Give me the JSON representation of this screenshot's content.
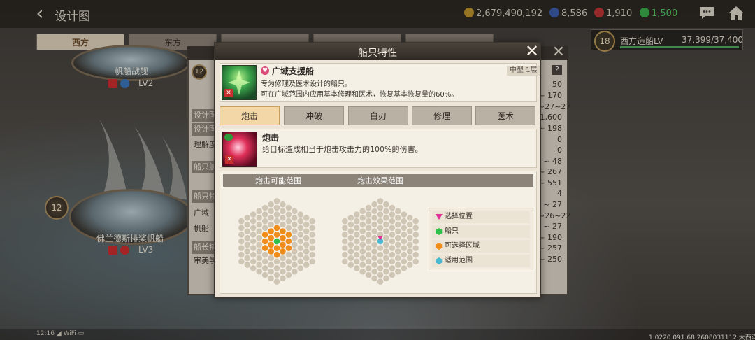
{
  "header": {
    "back_glyph": "‹",
    "title": "设计图"
  },
  "resources": [
    {
      "name": "gold",
      "value": "2,679,490,192",
      "color": "#b8912e"
    },
    {
      "name": "blue-gem",
      "value": "8,586",
      "color": "#3a5aa8"
    },
    {
      "name": "red-gem",
      "value": "1,910",
      "color": "#b83232"
    },
    {
      "name": "green-token",
      "value": "1,500",
      "color": "#3aa84a"
    }
  ],
  "top_icons": {
    "chat": "…",
    "home": "⌂"
  },
  "region_tabs": [
    "西方",
    "东方"
  ],
  "shipyard": {
    "level": "18",
    "label": "西方造船LV",
    "value": "37,399/37,400"
  },
  "ships": [
    {
      "name": "帆船战舰",
      "lv": "LV2"
    },
    {
      "name": "佛兰德斯排桨帆船",
      "lv": "LV3",
      "medal": "12"
    }
  ],
  "back_panel": {
    "medal": "12",
    "rows": [
      "设计图",
      "设计图",
      "理解度",
      "船只航",
      "船只特",
      "广域",
      "帆船",
      "船长搭",
      "审美学"
    ],
    "numbers": [
      "50",
      "~ 170",
      "~27~27",
      "1,600",
      "~ 198",
      "0",
      "0",
      "~ 48",
      "~ 267",
      "~ 551",
      "4",
      "~ 27",
      "~26~22",
      "~ 27",
      "~ 190",
      "~ 257",
      "~ 250"
    ],
    "help": "?"
  },
  "modal": {
    "title": "船只特性",
    "close": "✕",
    "ship": {
      "type_name": "广域支援船",
      "size": "中型 1层",
      "desc_lines": [
        "专为修理及医术设计的船只。",
        "可在广域范围内应用基本修理和医术，恢复基本恢复量的60%。"
      ]
    },
    "skill_tabs": [
      "炮击",
      "冲破",
      "白刃",
      "修理",
      "医术"
    ],
    "active_tab": 0,
    "skill": {
      "name": "炮击",
      "desc": "给目标造成相当于炮击攻击力的100%的伤害。"
    },
    "range": {
      "possible_title": "炮击可能范围",
      "effect_title": "炮击效果范围"
    },
    "legend": [
      {
        "label": "选择位置",
        "color": "#e0309a",
        "shape": "triangle"
      },
      {
        "label": "船只",
        "color": "#2fbf4a",
        "shape": "hexagon"
      },
      {
        "label": "可选择区域",
        "color": "#f08c1a",
        "shape": "hexagon"
      },
      {
        "label": "适用范围",
        "color": "#4ab8d0",
        "shape": "hexagon"
      }
    ]
  },
  "status": {
    "left": "12:16 ◢ WiFi ▭",
    "right": "1.0220.091.68 2608031112 大西洋"
  }
}
